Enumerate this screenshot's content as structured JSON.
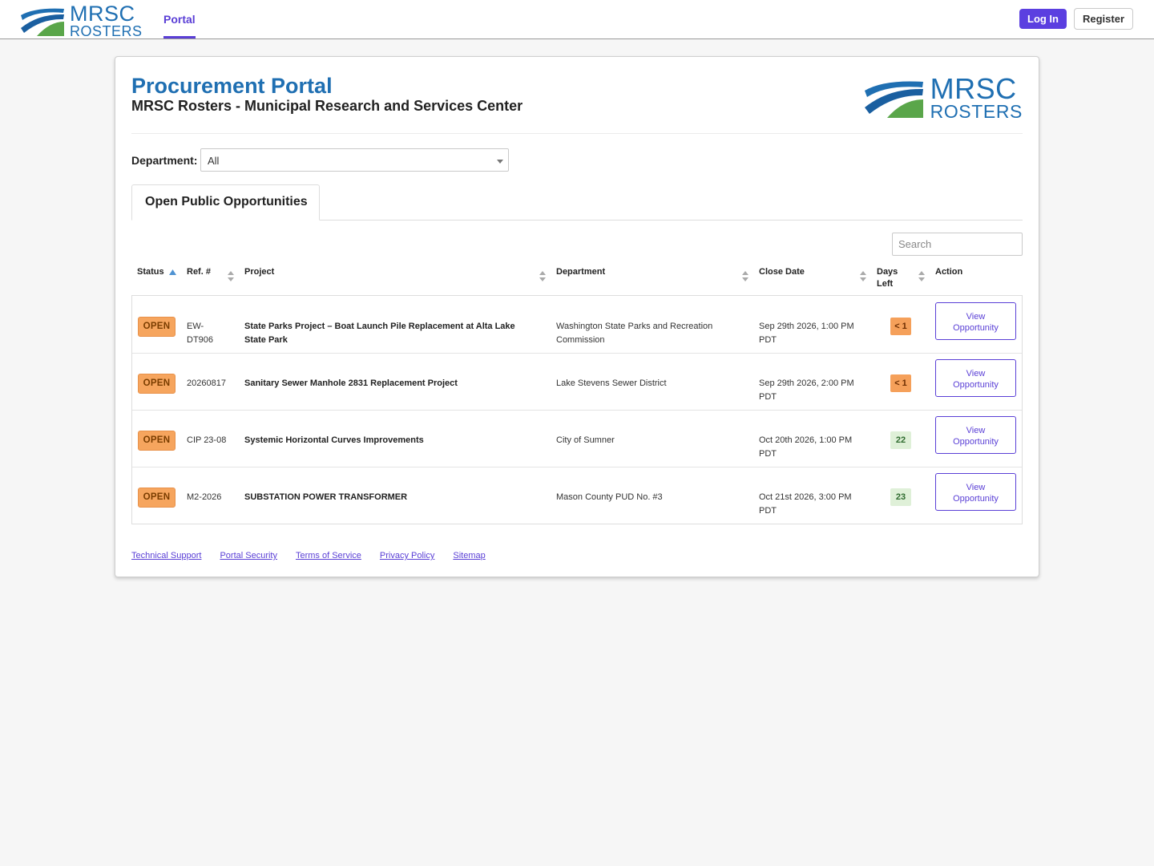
{
  "nav": {
    "logo_line1": "MRSC",
    "logo_line2": "ROSTERS",
    "portal_label": "Portal",
    "login_label": "Log In",
    "register_label": "Register"
  },
  "header": {
    "title": "Procurement Portal",
    "subtitle": "MRSC Rosters - Municipal Research and Services Center",
    "logo_line1": "MRSC",
    "logo_line2": "ROSTERS"
  },
  "filter": {
    "label": "Department:",
    "selected": "All"
  },
  "tab": {
    "label": "Open Public Opportunities"
  },
  "search": {
    "placeholder": "Search"
  },
  "table": {
    "headers": {
      "status": "Status",
      "ref": "Ref. #",
      "project": "Project",
      "department": "Department",
      "close_date": "Close Date",
      "days_left_1": "Days",
      "days_left_2": "Left",
      "action": "Action"
    },
    "rows": [
      {
        "status": "OPEN",
        "ref_1": "EW-",
        "ref_2": "DT906",
        "project_1": "State Parks Project – Boat Launch Pile Replacement at Alta Lake",
        "project_2": "State Park",
        "department_1": "Washington State Parks and Recreation",
        "department_2": "Commission",
        "close_1": "Sep 29th 2026, 1:00 PM",
        "close_2": "PDT",
        "days_left": "< 1",
        "action_1": "View",
        "action_2": "Opportunity"
      },
      {
        "status": "OPEN",
        "ref_1": "20260817",
        "ref_2": "",
        "project_1": "Sanitary Sewer Manhole 2831 Replacement Project",
        "project_2": "",
        "department_1": "Lake Stevens Sewer District",
        "department_2": "",
        "close_1": "Sep 29th 2026, 2:00 PM",
        "close_2": "PDT",
        "days_left": "< 1",
        "action_1": "View",
        "action_2": "Opportunity"
      },
      {
        "status": "OPEN",
        "ref_1": "CIP 23-08",
        "ref_2": "",
        "project_1": "Systemic Horizontal Curves Improvements",
        "project_2": "",
        "department_1": "City of Sumner",
        "department_2": "",
        "close_1": "Oct 20th 2026, 1:00 PM",
        "close_2": "PDT",
        "days_left": "22",
        "action_1": "View",
        "action_2": "Opportunity"
      },
      {
        "status": "OPEN",
        "ref_1": "M2-2026",
        "ref_2": "",
        "project_1": "SUBSTATION POWER TRANSFORMER",
        "project_2": "",
        "department_1": "Mason County PUD No. #3",
        "department_2": "",
        "close_1": "Oct 21st 2026, 3:00 PM",
        "close_2": "PDT",
        "days_left": "23",
        "action_1": "View",
        "action_2": "Opportunity"
      }
    ]
  },
  "footer": {
    "links": [
      "Technical Support",
      "Portal Security",
      "Terms of Service",
      "Privacy Policy",
      "Sitemap"
    ]
  },
  "colors": {
    "brand_blue": "#1f6fb2",
    "accent_purple": "#5a3fd6",
    "open_orange": "#f6a55e",
    "days_warn": "#f5a05a",
    "days_ok": "#dff0d8"
  }
}
